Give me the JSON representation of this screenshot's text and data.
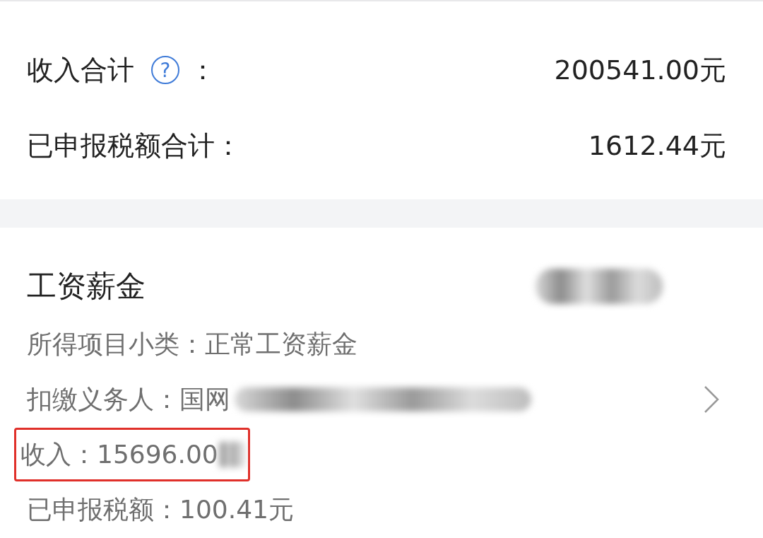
{
  "summary": {
    "rows": [
      {
        "label": "收入合计",
        "help_icon": "?",
        "colon": "：",
        "value": "200541.00元"
      },
      {
        "label": "已申报税额合计：",
        "value": "1612.44元"
      }
    ]
  },
  "detail": {
    "title": "工资薪金",
    "title_redacted": true,
    "lines": [
      {
        "text": "所得项目小类：正常工资薪金",
        "kind": "plain"
      },
      {
        "text": "扣缴义务人：国网",
        "kind": "redacted_link"
      },
      {
        "text": "收入：15696.00",
        "kind": "highlighted_redacted"
      },
      {
        "text": "已申报税额：100.41元",
        "kind": "plain"
      }
    ]
  }
}
